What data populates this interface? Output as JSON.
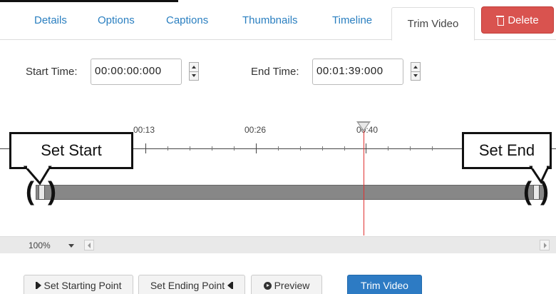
{
  "tabs": {
    "items": [
      {
        "label": "Details"
      },
      {
        "label": "Options"
      },
      {
        "label": "Captions"
      },
      {
        "label": "Thumbnails"
      },
      {
        "label": "Timeline"
      }
    ],
    "active": "Trim Video",
    "delete_label": "Delete"
  },
  "trim": {
    "start_label": "Start Time:",
    "start_value": "00:00:00:000",
    "end_label": "End Time:",
    "end_value": "00:01:39:000"
  },
  "timeline": {
    "ticks": [
      "00:13",
      "00:26",
      "00:40"
    ],
    "playhead_color": "#e03030"
  },
  "callouts": {
    "start": "Set Start",
    "end": "Set End"
  },
  "zoom": {
    "value": "100%"
  },
  "buttons": {
    "set_start": "Set Starting Point",
    "set_end": "Set Ending Point",
    "preview": "Preview",
    "trim": "Trim Video"
  },
  "colors": {
    "accent": "#2a7fc0",
    "danger": "#d9534f",
    "primary": "#2d7bc4"
  }
}
